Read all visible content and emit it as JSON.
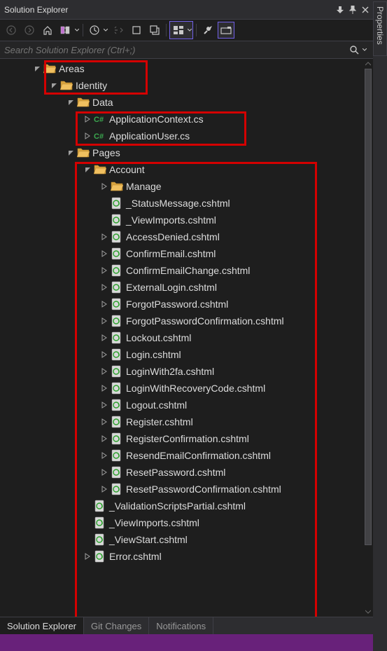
{
  "titlebar": {
    "title": "Solution Explorer"
  },
  "search": {
    "placeholder": "Search Solution Explorer (Ctrl+;)"
  },
  "side_tab": "Properties",
  "tabs": [
    {
      "label": "Solution Explorer",
      "active": true
    },
    {
      "label": "Git Changes",
      "active": false
    },
    {
      "label": "Notifications",
      "active": false
    }
  ],
  "tree": {
    "Areas": {
      "label": "Areas",
      "Identity": {
        "label": "Identity",
        "Data": {
          "label": "Data",
          "ApplicationContext": "ApplicationContext.cs",
          "ApplicationUser": "ApplicationUser.cs"
        },
        "Pages": {
          "label": "Pages",
          "Account": {
            "label": "Account",
            "Manage": {
              "label": "Manage"
            },
            "StatusMessage": "_StatusMessage.cshtml",
            "ViewImports": "_ViewImports.cshtml",
            "AccessDenied": "AccessDenied.cshtml",
            "ConfirmEmail": "ConfirmEmail.cshtml",
            "ConfirmEmailChange": "ConfirmEmailChange.cshtml",
            "ExternalLogin": "ExternalLogin.cshtml",
            "ForgotPassword": "ForgotPassword.cshtml",
            "ForgotPasswordConfirmation": "ForgotPasswordConfirmation.cshtml",
            "Lockout": "Lockout.cshtml",
            "Login": "Login.cshtml",
            "LoginWith2fa": "LoginWith2fa.cshtml",
            "LoginWithRecoveryCode": "LoginWithRecoveryCode.cshtml",
            "Logout": "Logout.cshtml",
            "Register": "Register.cshtml",
            "RegisterConfirmation": "RegisterConfirmation.cshtml",
            "ResendEmailConfirmation": "ResendEmailConfirmation.cshtml",
            "ResetPassword": "ResetPassword.cshtml",
            "ResetPasswordConfirmation": "ResetPasswordConfirmation.cshtml"
          },
          "ValidationScriptsPartial": "_ValidationScriptsPartial.cshtml",
          "PagesViewImports": "_ViewImports.cshtml",
          "PagesViewStart": "_ViewStart.cshtml",
          "Error": "Error.cshtml"
        }
      }
    }
  }
}
